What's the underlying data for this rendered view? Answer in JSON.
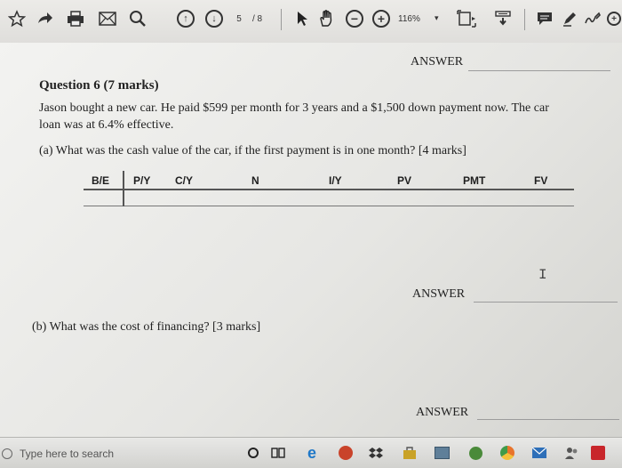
{
  "toolbar": {
    "current_page": "5",
    "page_total": "/ 8",
    "zoom": "116%",
    "zoom_dropdown": "▾"
  },
  "document": {
    "answer_top": "ANSWER",
    "question_title": "Question 6 (7 marks)",
    "question_line1": "Jason bought a new car.  He paid $599 per month for 3 years and a $1,500 down payment now.  The car",
    "question_line2": "loan was at 6.4% effective.",
    "part_a": "(a)  What was the cash value of the car, if the first payment is in one month?  [4 marks]",
    "tvm_headers": [
      "B/E",
      "P/Y",
      "C/Y",
      "N",
      "I/Y",
      "PV",
      "PMT",
      "FV"
    ],
    "text_cursor": "I",
    "answer_mid": "ANSWER",
    "part_b": "(b)  What was the cost of financing? [3 marks]",
    "answer_bottom": "ANSWER"
  },
  "taskbar": {
    "search_placeholder": "Type here to search"
  },
  "colors": {
    "page": "#f0f0ee",
    "toolbar": "#e6e5e2",
    "edge_blue": "#1f78c8",
    "store_gold": "#c9a227",
    "chrome_orange": "#e8742c"
  }
}
